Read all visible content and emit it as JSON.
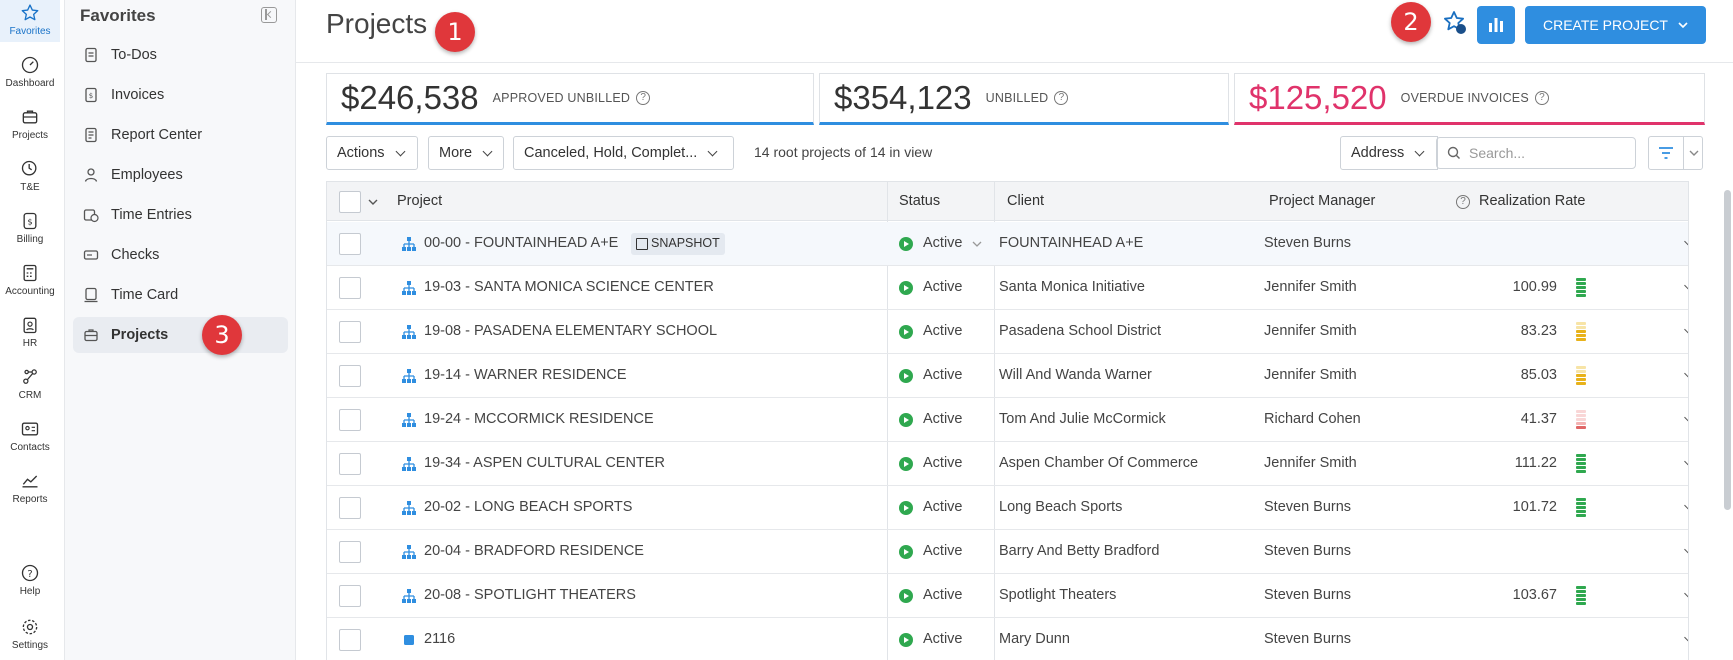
{
  "rail": {
    "items": [
      {
        "label": "Favorites",
        "icon": "star-icon",
        "active": true
      },
      {
        "label": "Dashboard",
        "icon": "gauge-icon"
      },
      {
        "label": "Projects",
        "icon": "briefcase-icon"
      },
      {
        "label": "T&E",
        "icon": "clock-dollar-icon"
      },
      {
        "label": "Billing",
        "icon": "dollar-doc-icon"
      },
      {
        "label": "Accounting",
        "icon": "calculator-icon"
      },
      {
        "label": "HR",
        "icon": "id-badge-icon"
      },
      {
        "label": "CRM",
        "icon": "network-icon"
      },
      {
        "label": "Contacts",
        "icon": "contact-card-icon"
      },
      {
        "label": "Reports",
        "icon": "line-chart-icon"
      },
      {
        "label": "Help",
        "icon": "help-circle-icon"
      },
      {
        "label": "Settings",
        "icon": "gear-icon"
      }
    ]
  },
  "favorites": {
    "title": "Favorites",
    "items": [
      {
        "label": "To-Dos",
        "icon": "checklist-icon"
      },
      {
        "label": "Invoices",
        "icon": "invoice-icon"
      },
      {
        "label": "Report Center",
        "icon": "report-icon"
      },
      {
        "label": "Employees",
        "icon": "person-icon"
      },
      {
        "label": "Time Entries",
        "icon": "calendar-clock-icon"
      },
      {
        "label": "Checks",
        "icon": "check-icon"
      },
      {
        "label": "Time Card",
        "icon": "timecard-icon"
      },
      {
        "label": "Projects",
        "icon": "briefcase-icon",
        "active": true
      }
    ]
  },
  "header": {
    "title": "Projects",
    "create_label": "CREATE PROJECT",
    "accent": "#2f8ee0"
  },
  "callouts": [
    "1",
    "2",
    "3"
  ],
  "kpis": [
    {
      "value": "$246,538",
      "label": "APPROVED UNBILLED"
    },
    {
      "value": "$354,123",
      "label": "UNBILLED"
    },
    {
      "value": "$125,520",
      "label": "OVERDUE INVOICES",
      "color": "#e0336b"
    }
  ],
  "toolbar": {
    "actions_label": "Actions",
    "more_label": "More",
    "status_filter": "Canceled, Hold, Complet...",
    "count_text": "14 root projects of 14 in view",
    "address_label": "Address",
    "search_placeholder": "Search..."
  },
  "table": {
    "columns": [
      "Project",
      "Status",
      "Client",
      "Project Manager",
      "Realization Rate"
    ],
    "rows": [
      {
        "project": "00-00 - FOUNTAINHEAD A+E",
        "tag": "SNAPSHOT",
        "status": "Active",
        "client": "FOUNTAINHEAD A+E",
        "manager": "Steven Burns",
        "rate": "",
        "meter": ""
      },
      {
        "project": "19-03 - SANTA MONICA SCIENCE CENTER",
        "status": "Active",
        "client": "Santa Monica Initiative",
        "manager": "Jennifer Smith",
        "rate": "100.99",
        "meter": "green"
      },
      {
        "project": "19-08 - PASADENA ELEMENTARY SCHOOL",
        "status": "Active",
        "client": "Pasadena School District",
        "manager": "Jennifer Smith",
        "rate": "83.23",
        "meter": "yellow"
      },
      {
        "project": "19-14 - WARNER RESIDENCE",
        "status": "Active",
        "client": "Will And Wanda Warner",
        "manager": "Jennifer Smith",
        "rate": "85.03",
        "meter": "yellow"
      },
      {
        "project": "19-24 - MCCORMICK RESIDENCE",
        "status": "Active",
        "client": "Tom And Julie McCormick",
        "manager": "Richard Cohen",
        "rate": "41.37",
        "meter": "red"
      },
      {
        "project": "19-34 - ASPEN CULTURAL CENTER",
        "status": "Active",
        "client": "Aspen Chamber Of Commerce",
        "manager": "Jennifer Smith",
        "rate": "111.22",
        "meter": "green"
      },
      {
        "project": "20-02 - LONG BEACH SPORTS",
        "status": "Active",
        "client": "Long Beach Sports",
        "manager": "Steven Burns",
        "rate": "101.72",
        "meter": "green"
      },
      {
        "project": "20-04 - BRADFORD RESIDENCE",
        "status": "Active",
        "client": "Barry And Betty Bradford",
        "manager": "Steven Burns",
        "rate": "",
        "meter": ""
      },
      {
        "project": "20-08 - SPOTLIGHT THEATERS",
        "status": "Active",
        "client": "Spotlight Theaters",
        "manager": "Steven Burns",
        "rate": "103.67",
        "meter": "green"
      },
      {
        "project": "2116",
        "status": "Active",
        "client": "Mary Dunn",
        "manager": "Steven Burns",
        "rate": "",
        "meter": "",
        "leaf": true
      }
    ]
  }
}
